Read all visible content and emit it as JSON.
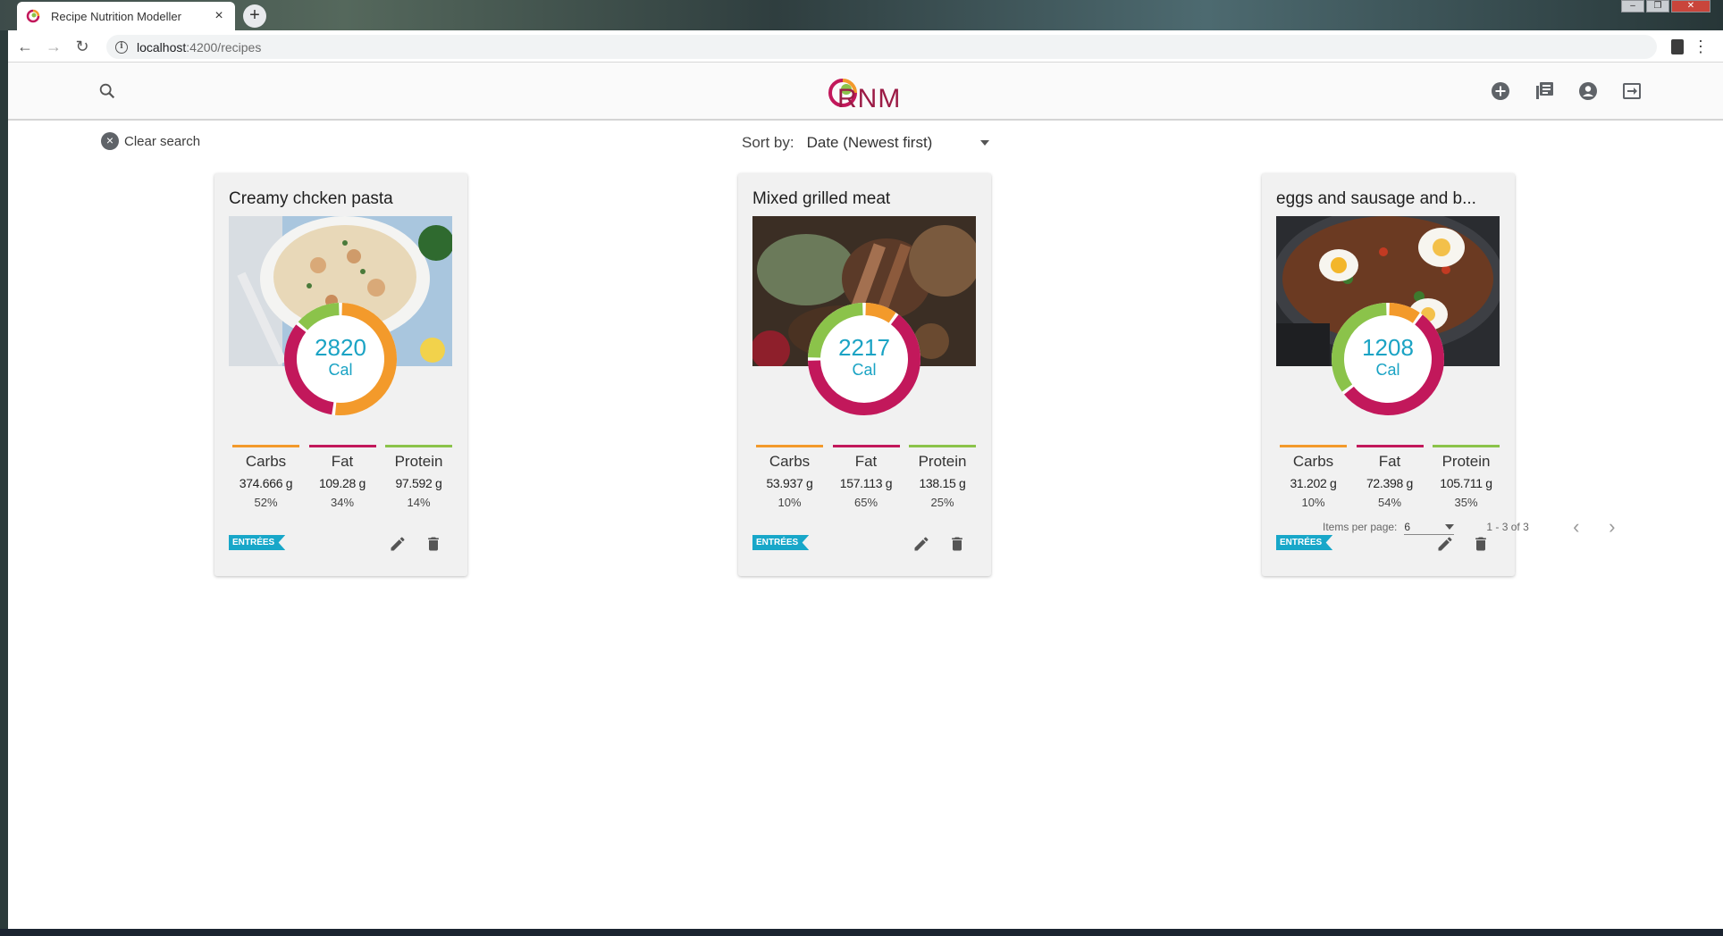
{
  "browser": {
    "tab_title": "Recipe Nutrition Modeller",
    "tab_close": "×",
    "new_tab": "+",
    "url_host": "localhost",
    "url_path": ":4200/recipes",
    "window_controls": [
      "–",
      "❐",
      "✕"
    ]
  },
  "app": {
    "logo_text": "RNM",
    "clear_search_label": "Clear search",
    "clear_icon": "×",
    "sort_label": "Sort by:",
    "sort_value": "Date (Newest first)",
    "brand_colors": {
      "carbs": "#f39a2b",
      "fat": "#c2185b",
      "protein": "#8bc34a",
      "calories": "#1aa3c4",
      "category": "#18a7c9"
    }
  },
  "recipes": [
    {
      "title": "Creamy chcken pasta",
      "calories": "2820",
      "cal_unit": "Cal",
      "category": "ENTRÉES",
      "macros": [
        {
          "name": "Carbs",
          "amount": "374.666 g",
          "percent": "52%",
          "fraction": 0.52
        },
        {
          "name": "Fat",
          "amount": "109.28 g",
          "percent": "34%",
          "fraction": 0.34
        },
        {
          "name": "Protein",
          "amount": "97.592 g",
          "percent": "14%",
          "fraction": 0.14
        }
      ]
    },
    {
      "title": "Mixed grilled meat",
      "calories": "2217",
      "cal_unit": "Cal",
      "category": "ENTRÉES",
      "macros": [
        {
          "name": "Carbs",
          "amount": "53.937 g",
          "percent": "10%",
          "fraction": 0.1
        },
        {
          "name": "Fat",
          "amount": "157.113 g",
          "percent": "65%",
          "fraction": 0.65
        },
        {
          "name": "Protein",
          "amount": "138.15 g",
          "percent": "25%",
          "fraction": 0.25
        }
      ]
    },
    {
      "title": "eggs and sausage and b...",
      "calories": "1208",
      "cal_unit": "Cal",
      "category": "ENTRÉES",
      "macros": [
        {
          "name": "Carbs",
          "amount": "31.202 g",
          "percent": "10%",
          "fraction": 0.1
        },
        {
          "name": "Fat",
          "amount": "72.398 g",
          "percent": "54%",
          "fraction": 0.54
        },
        {
          "name": "Protein",
          "amount": "105.711 g",
          "percent": "35%",
          "fraction": 0.35
        }
      ]
    }
  ],
  "paginator": {
    "items_per_page_label": "Items per page:",
    "items_per_page_value": "6",
    "range_label": "1 - 3 of 3",
    "prev": "‹",
    "next": "›"
  }
}
